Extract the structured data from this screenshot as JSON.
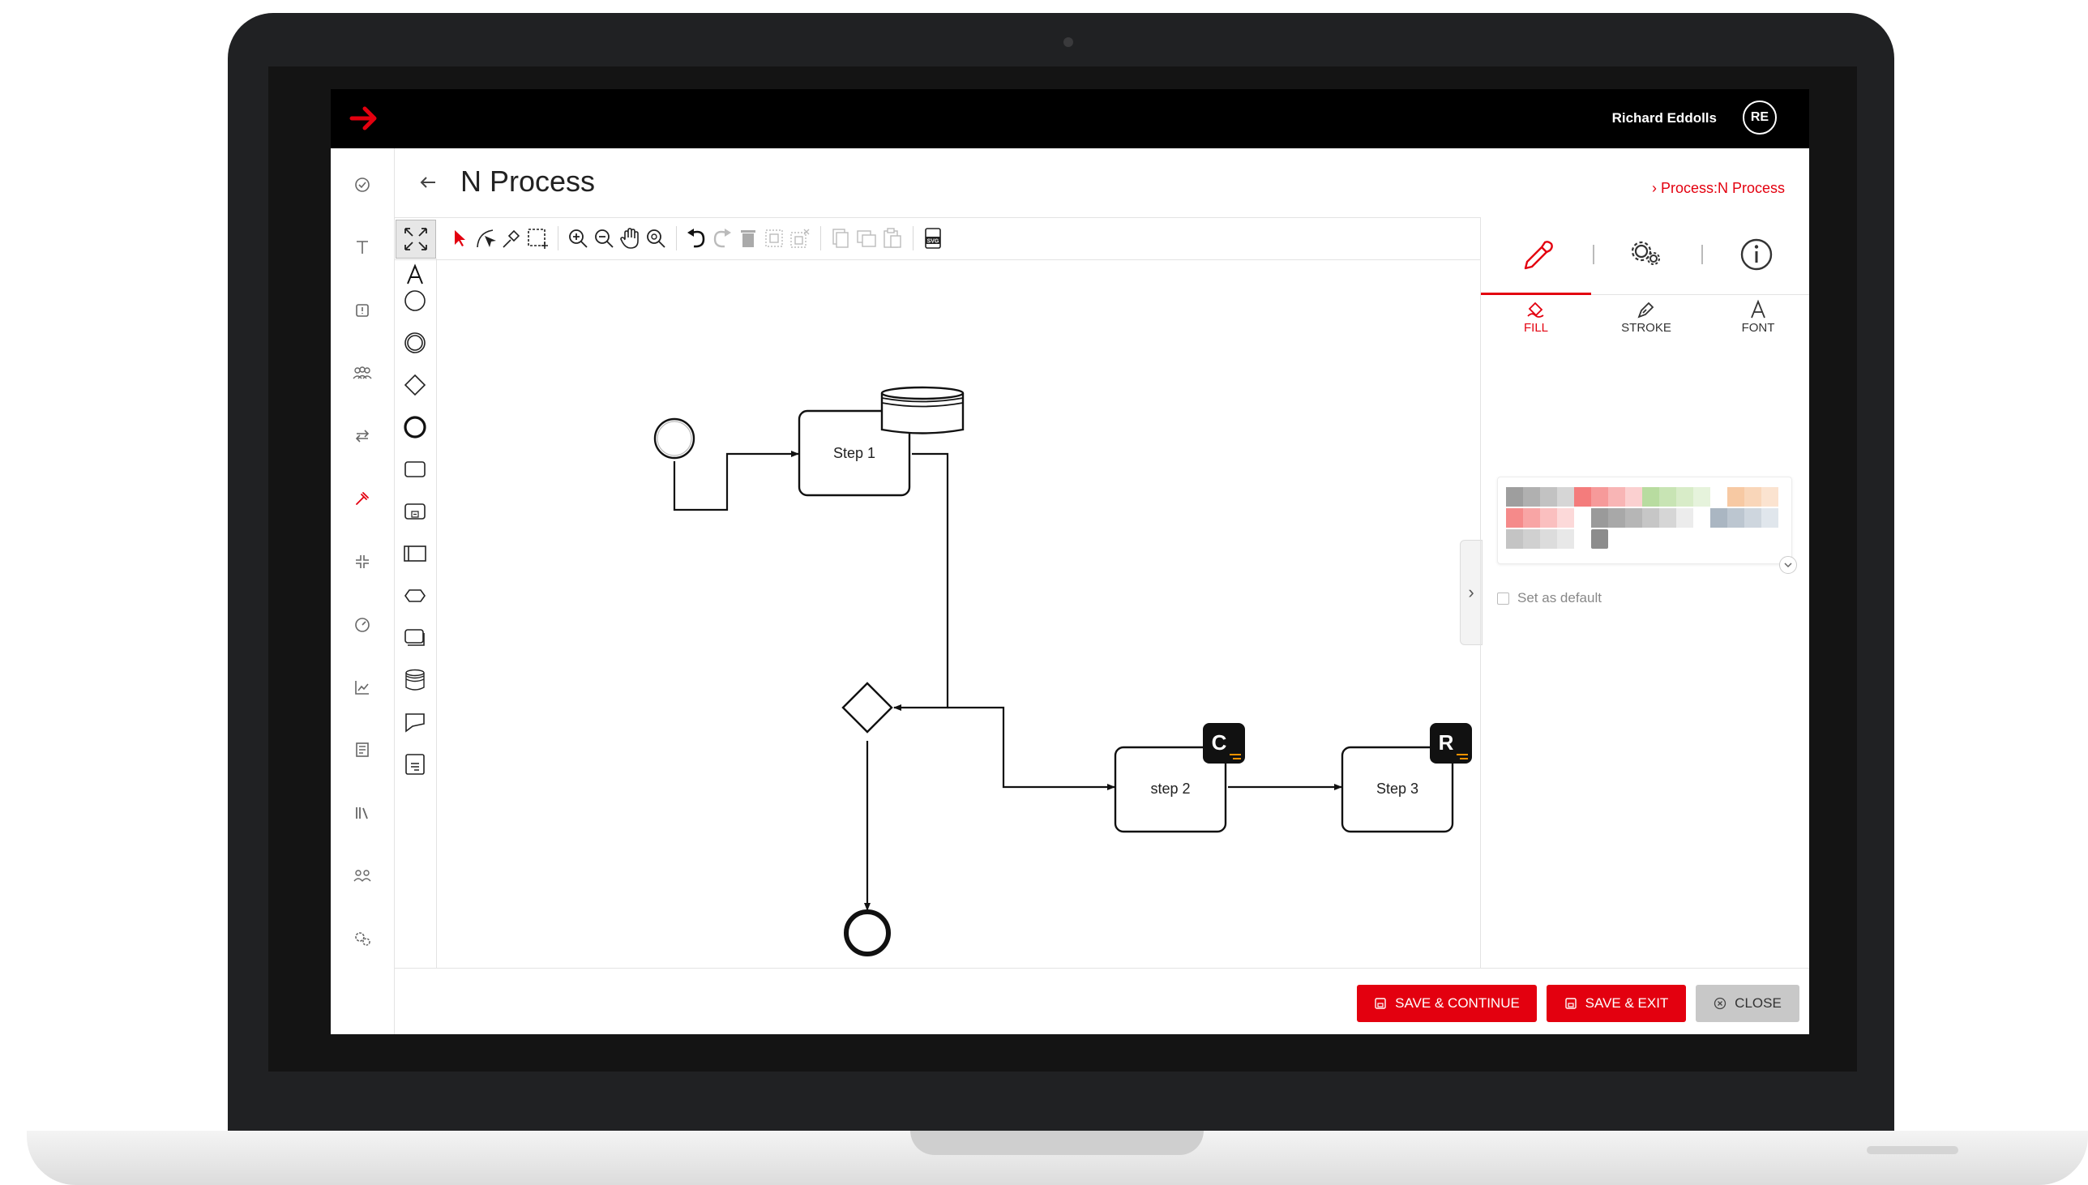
{
  "app": {
    "user_name": "Richard Eddolls",
    "user_initials": "RE",
    "page_title": "N Process",
    "breadcrumb": "Process:N Process"
  },
  "sidebar": {
    "items": [
      {
        "icon": "check-circle-icon"
      },
      {
        "icon": "text-icon"
      },
      {
        "icon": "alert-box-icon"
      },
      {
        "icon": "team-icon"
      },
      {
        "icon": "swap-arrows-icon"
      },
      {
        "icon": "hammer-icon",
        "active": true
      },
      {
        "icon": "collapse-arrows-icon"
      },
      {
        "icon": "gauge-icon"
      },
      {
        "icon": "line-chart-icon"
      },
      {
        "icon": "document-list-icon"
      },
      {
        "icon": "library-icon"
      },
      {
        "icon": "group-icon"
      },
      {
        "icon": "settings-gears-icon"
      }
    ]
  },
  "toolbar": {
    "tools": [
      "fit-icon",
      "pointer-icon",
      "connect-curve-icon",
      "pen-icon",
      "marquee-select-icon",
      "zoom-in-icon",
      "zoom-out-icon",
      "pan-hand-icon",
      "zoom-fit-icon",
      "undo-icon",
      "redo-icon",
      "delete-icon",
      "group-icon",
      "ungroup-icon",
      "copy-icon",
      "duplicate-icon",
      "paste-icon",
      "export-svg-icon"
    ],
    "svg_label": "SVG"
  },
  "diagram": {
    "nodes": [
      {
        "id": "step1",
        "label": "Step 1"
      },
      {
        "id": "step2",
        "label": "step 2",
        "badge": "C"
      },
      {
        "id": "step3",
        "label": "Step 3",
        "badge": "R"
      }
    ]
  },
  "right_panel": {
    "tabs": [
      "style-brush-icon",
      "settings-gears-icon",
      "info-icon"
    ],
    "subtabs": [
      {
        "label": "FILL",
        "icon": "paint-bucket-icon",
        "active": true
      },
      {
        "label": "STROKE",
        "icon": "pen-nib-icon"
      },
      {
        "label": "FONT",
        "icon": "font-a-icon"
      }
    ],
    "set_default_label": "Set as default",
    "accent": "#e3000f"
  },
  "footer": {
    "save_continue": "SAVE & CONTINUE",
    "save_exit": "SAVE & EXIT",
    "close": "CLOSE"
  }
}
